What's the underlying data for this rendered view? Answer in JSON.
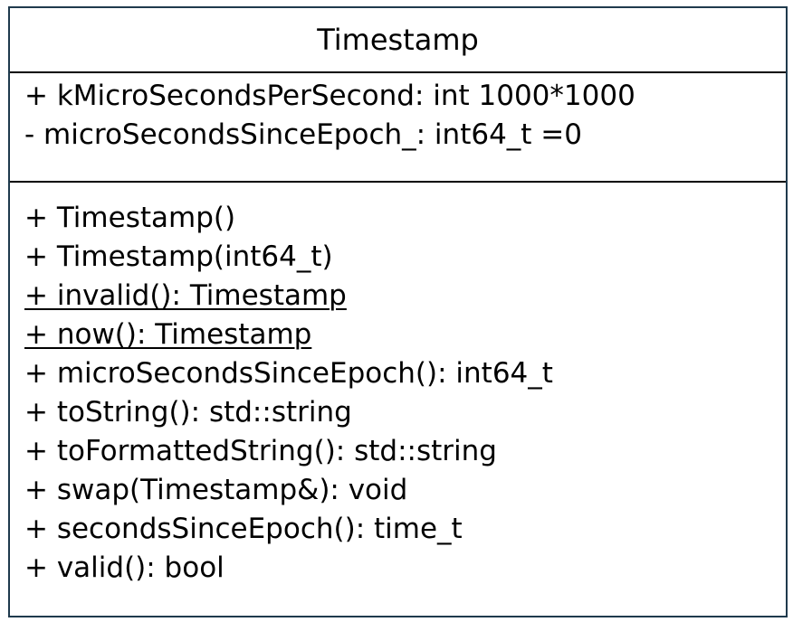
{
  "class_name": "Timestamp",
  "attributes": [
    {
      "text": "+ kMicroSecondsPerSecond: int 1000*1000",
      "static": false
    },
    {
      "text": "- microSecondsSinceEpoch_: int64_t =0",
      "static": false
    }
  ],
  "methods": [
    {
      "text": "+ Timestamp()",
      "static": false
    },
    {
      "text": "+ Timestamp(int64_t)",
      "static": false
    },
    {
      "text": "+ invalid(): Timestamp",
      "static": true
    },
    {
      "text": "+ now(): Timestamp",
      "static": true
    },
    {
      "text": "+ microSecondsSinceEpoch(): int64_t",
      "static": false
    },
    {
      "text": "+ toString(): std::string",
      "static": false
    },
    {
      "text": "+ toFormattedString(): std::string",
      "static": false
    },
    {
      "text": "+ swap(Timestamp&): void",
      "static": false
    },
    {
      "text": "+ secondsSinceEpoch(): time_t",
      "static": false
    },
    {
      "text": "+ valid(): bool",
      "static": false
    }
  ],
  "colors": {
    "border": "#1f3a4d",
    "divider": "#000000",
    "text": "#000000",
    "background": "#ffffff"
  }
}
